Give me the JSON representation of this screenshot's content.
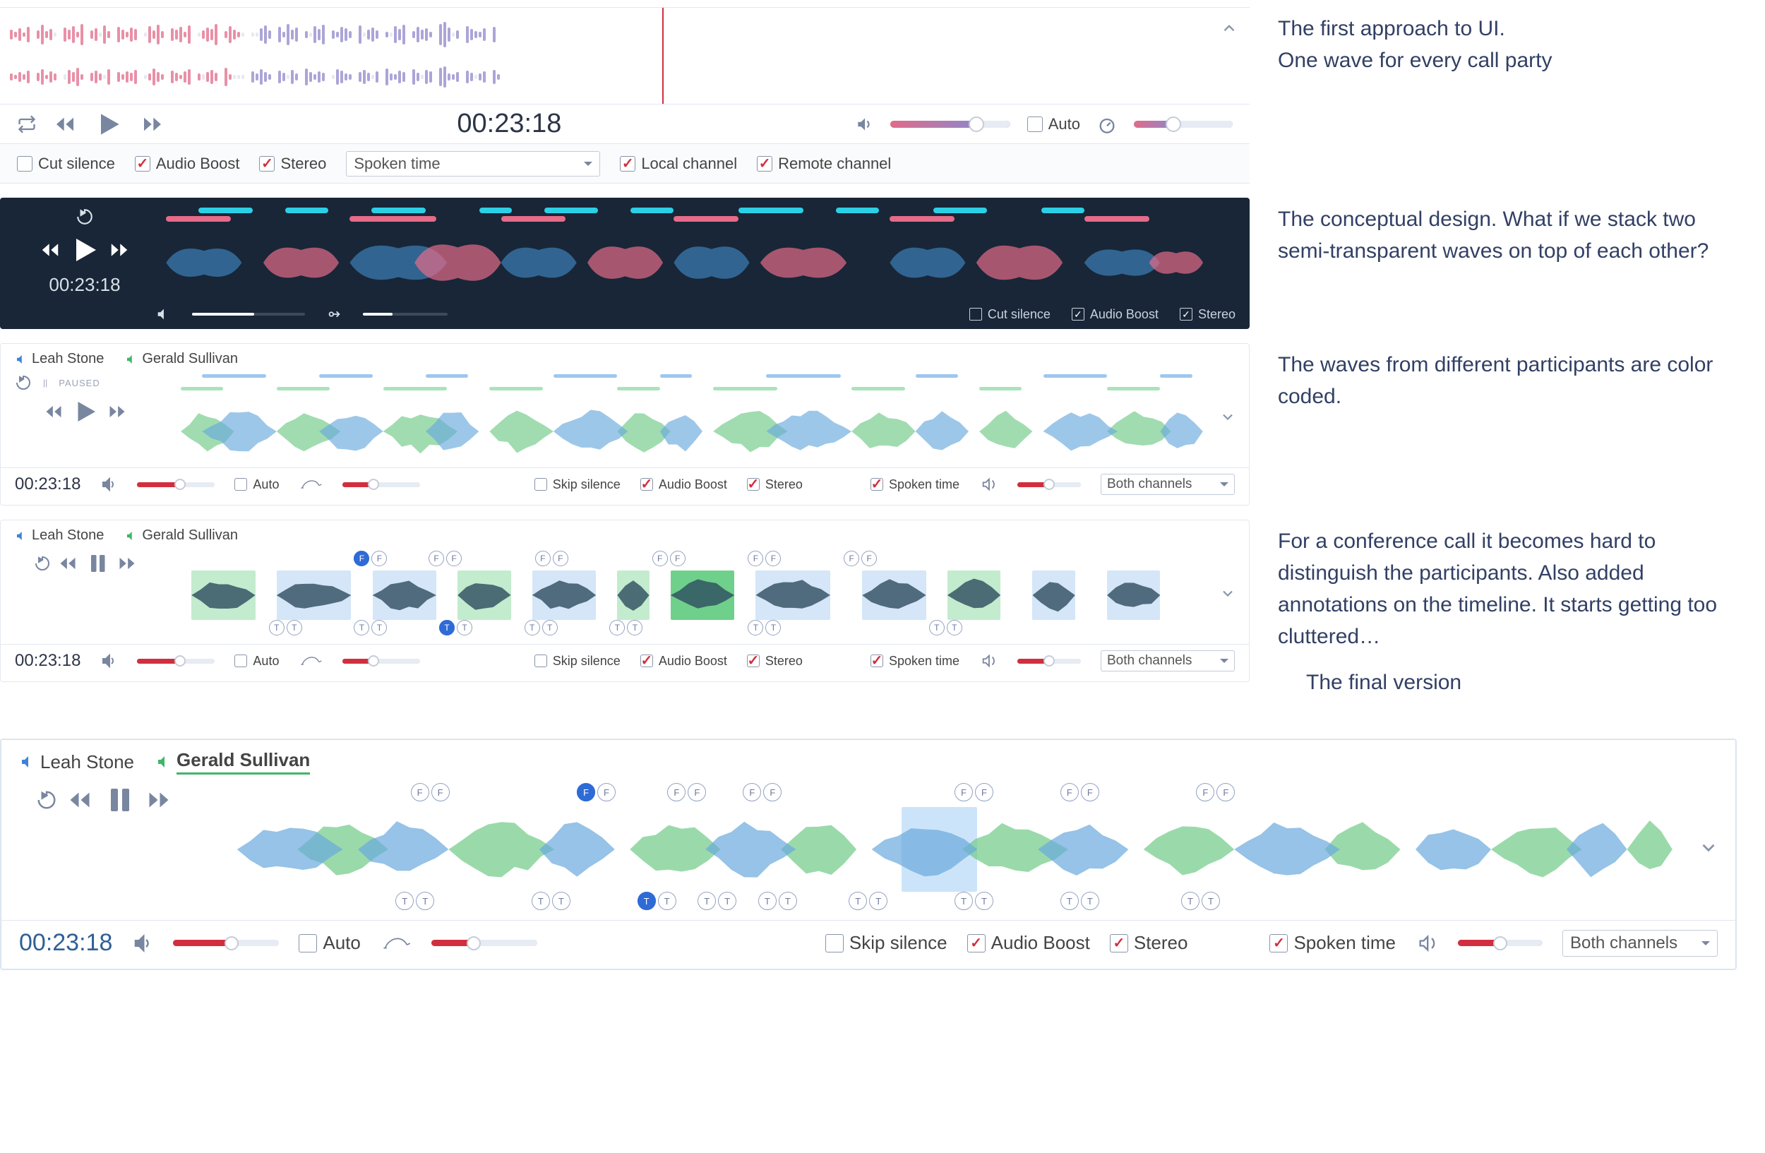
{
  "captions": {
    "c1a": "The first approach to UI.",
    "c1b": "One wave for every call party",
    "c2": "The conceptual design. What if we stack two semi-transparent waves on top of each other?",
    "c3": "The waves from different participants are color coded.",
    "c4": "For a conference call it becomes hard to distinguish the participants. Also added annotations on the timeline. It starts getting too cluttered…",
    "c5": "The final version"
  },
  "participants": {
    "a": "Leah Stone",
    "b": "Gerald Sullivan"
  },
  "time": "00:23:18",
  "paused": "PAUSED",
  "selectors": {
    "spoken": "Spoken time",
    "both": "Both channels"
  },
  "options": {
    "cut": "Cut silence",
    "boost": "Audio Boost",
    "stereo": "Stereo",
    "local": "Local channel",
    "remote": "Remote channel",
    "auto": "Auto",
    "skip": "Skip silence",
    "spoken": "Spoken time"
  },
  "waves1": {
    "top": [
      [
        14,
        "p"
      ],
      [
        8,
        "p"
      ],
      [
        18,
        "p"
      ],
      [
        6,
        "p"
      ],
      [
        22,
        "p"
      ],
      [
        12,
        "p"
      ],
      [
        28,
        "p"
      ],
      [
        10,
        "p"
      ],
      [
        16,
        "p"
      ],
      [
        6,
        "g"
      ],
      [
        20,
        "p"
      ],
      [
        14,
        "p"
      ],
      [
        24,
        "p"
      ],
      [
        8,
        "p"
      ],
      [
        30,
        "p"
      ],
      [
        12,
        "p"
      ],
      [
        18,
        "p"
      ],
      [
        6,
        "g"
      ],
      [
        26,
        "p"
      ],
      [
        10,
        "p"
      ],
      [
        22,
        "p"
      ],
      [
        14,
        "p"
      ],
      [
        8,
        "p"
      ],
      [
        20,
        "p"
      ],
      [
        16,
        "p"
      ],
      [
        6,
        "g"
      ],
      [
        24,
        "p"
      ],
      [
        12,
        "p"
      ],
      [
        28,
        "p"
      ],
      [
        10,
        "p"
      ],
      [
        18,
        "p"
      ],
      [
        14,
        "p"
      ],
      [
        22,
        "p"
      ],
      [
        8,
        "p"
      ],
      [
        26,
        "p"
      ],
      [
        6,
        "g"
      ],
      [
        12,
        "p"
      ],
      [
        20,
        "p"
      ],
      [
        16,
        "p"
      ],
      [
        30,
        "p"
      ],
      [
        10,
        "p"
      ],
      [
        24,
        "p"
      ],
      [
        14,
        "p"
      ],
      [
        8,
        "p"
      ],
      [
        6,
        "g"
      ],
      [
        6,
        "g"
      ],
      [
        6,
        "g"
      ],
      [
        18,
        "u"
      ],
      [
        26,
        "u"
      ],
      [
        12,
        "u"
      ],
      [
        22,
        "u"
      ],
      [
        8,
        "u"
      ],
      [
        30,
        "u"
      ],
      [
        14,
        "u"
      ],
      [
        20,
        "u"
      ],
      [
        10,
        "u"
      ],
      [
        6,
        "g"
      ],
      [
        24,
        "u"
      ],
      [
        16,
        "u"
      ],
      [
        28,
        "u"
      ],
      [
        12,
        "u"
      ],
      [
        8,
        "u"
      ],
      [
        22,
        "u"
      ],
      [
        18,
        "u"
      ],
      [
        10,
        "u"
      ],
      [
        26,
        "u"
      ],
      [
        6,
        "g"
      ],
      [
        14,
        "u"
      ],
      [
        20,
        "u"
      ],
      [
        12,
        "u"
      ],
      [
        8,
        "u"
      ],
      [
        6,
        "g"
      ],
      [
        24,
        "u"
      ],
      [
        16,
        "u"
      ],
      [
        28,
        "u"
      ],
      [
        10,
        "u"
      ],
      [
        22,
        "u"
      ],
      [
        14,
        "u"
      ],
      [
        18,
        "u"
      ],
      [
        8,
        "u"
      ],
      [
        30,
        "u"
      ],
      [
        36,
        "u"
      ],
      [
        20,
        "u"
      ],
      [
        6,
        "g"
      ],
      [
        12,
        "u"
      ],
      [
        24,
        "u"
      ],
      [
        16,
        "u"
      ],
      [
        10,
        "u"
      ],
      [
        8,
        "u"
      ],
      [
        18,
        "u"
      ],
      [
        22,
        "u"
      ]
    ],
    "bot": [
      [
        10,
        "p"
      ],
      [
        6,
        "p"
      ],
      [
        14,
        "p"
      ],
      [
        8,
        "p"
      ],
      [
        18,
        "p"
      ],
      [
        12,
        "p"
      ],
      [
        22,
        "p"
      ],
      [
        6,
        "p"
      ],
      [
        16,
        "p"
      ],
      [
        10,
        "p"
      ],
      [
        8,
        "g"
      ],
      [
        20,
        "p"
      ],
      [
        14,
        "p"
      ],
      [
        26,
        "p"
      ],
      [
        8,
        "p"
      ],
      [
        12,
        "p"
      ],
      [
        18,
        "p"
      ],
      [
        10,
        "p"
      ],
      [
        6,
        "g"
      ],
      [
        22,
        "p"
      ],
      [
        14,
        "p"
      ],
      [
        8,
        "p"
      ],
      [
        16,
        "p"
      ],
      [
        12,
        "p"
      ],
      [
        20,
        "p"
      ],
      [
        6,
        "g"
      ],
      [
        10,
        "p"
      ],
      [
        24,
        "p"
      ],
      [
        14,
        "p"
      ],
      [
        8,
        "p"
      ],
      [
        18,
        "p"
      ],
      [
        12,
        "p"
      ],
      [
        6,
        "p"
      ],
      [
        16,
        "p"
      ],
      [
        22,
        "p"
      ],
      [
        10,
        "p"
      ],
      [
        8,
        "g"
      ],
      [
        14,
        "p"
      ],
      [
        20,
        "p"
      ],
      [
        12,
        "p"
      ],
      [
        26,
        "p"
      ],
      [
        8,
        "p"
      ],
      [
        6,
        "g"
      ],
      [
        6,
        "g"
      ],
      [
        6,
        "g"
      ],
      [
        16,
        "u"
      ],
      [
        10,
        "u"
      ],
      [
        22,
        "u"
      ],
      [
        14,
        "u"
      ],
      [
        8,
        "u"
      ],
      [
        18,
        "u"
      ],
      [
        12,
        "u"
      ],
      [
        6,
        "g"
      ],
      [
        20,
        "u"
      ],
      [
        10,
        "u"
      ],
      [
        24,
        "u"
      ],
      [
        14,
        "u"
      ],
      [
        8,
        "u"
      ],
      [
        16,
        "u"
      ],
      [
        12,
        "u"
      ],
      [
        6,
        "g"
      ],
      [
        22,
        "u"
      ],
      [
        18,
        "u"
      ],
      [
        10,
        "u"
      ],
      [
        8,
        "u"
      ],
      [
        14,
        "u"
      ],
      [
        20,
        "u"
      ],
      [
        12,
        "u"
      ],
      [
        6,
        "g"
      ],
      [
        16,
        "u"
      ],
      [
        24,
        "u"
      ],
      [
        10,
        "u"
      ],
      [
        8,
        "u"
      ],
      [
        18,
        "u"
      ],
      [
        14,
        "u"
      ],
      [
        22,
        "u"
      ],
      [
        12,
        "u"
      ],
      [
        6,
        "g"
      ],
      [
        20,
        "u"
      ],
      [
        16,
        "u"
      ],
      [
        26,
        "u"
      ],
      [
        30,
        "u"
      ],
      [
        10,
        "u"
      ],
      [
        8,
        "u"
      ],
      [
        14,
        "u"
      ],
      [
        18,
        "u"
      ],
      [
        12,
        "u"
      ],
      [
        6,
        "g"
      ],
      [
        10,
        "u"
      ],
      [
        16,
        "u"
      ],
      [
        20,
        "u"
      ],
      [
        8,
        "u"
      ]
    ]
  },
  "segments2": {
    "cyan": [
      [
        4,
        5
      ],
      [
        12,
        4
      ],
      [
        20,
        5
      ],
      [
        30,
        3
      ],
      [
        36,
        5
      ],
      [
        44,
        4
      ],
      [
        54,
        6
      ],
      [
        63,
        4
      ],
      [
        72,
        5
      ],
      [
        82,
        4
      ]
    ],
    "pink": [
      [
        1,
        6
      ],
      [
        18,
        8
      ],
      [
        32,
        6
      ],
      [
        48,
        6
      ],
      [
        68,
        6
      ],
      [
        86,
        6
      ]
    ]
  },
  "blobs2": {
    "blue": [
      [
        1,
        7,
        28
      ],
      [
        18,
        9,
        34
      ],
      [
        32,
        7,
        30
      ],
      [
        48,
        7,
        32
      ],
      [
        68,
        7,
        30
      ],
      [
        86,
        7,
        26
      ]
    ],
    "pink": [
      [
        10,
        7,
        30
      ],
      [
        24,
        8,
        36
      ],
      [
        40,
        7,
        32
      ],
      [
        56,
        8,
        30
      ],
      [
        76,
        8,
        34
      ],
      [
        92,
        5,
        22
      ]
    ]
  },
  "segments3": {
    "blue": [
      [
        3,
        6
      ],
      [
        14,
        5
      ],
      [
        24,
        4
      ],
      [
        36,
        6
      ],
      [
        46,
        3
      ],
      [
        56,
        7
      ],
      [
        70,
        4
      ],
      [
        82,
        6
      ],
      [
        93,
        3
      ]
    ],
    "green": [
      [
        1,
        4
      ],
      [
        10,
        5
      ],
      [
        20,
        6
      ],
      [
        30,
        5
      ],
      [
        42,
        4
      ],
      [
        51,
        6
      ],
      [
        64,
        5
      ],
      [
        76,
        4
      ],
      [
        88,
        5
      ]
    ]
  },
  "wave3": {
    "blue": [
      [
        3,
        7
      ],
      [
        14,
        6
      ],
      [
        24,
        5
      ],
      [
        36,
        7
      ],
      [
        46,
        4
      ],
      [
        56,
        8
      ],
      [
        70,
        5
      ],
      [
        82,
        7
      ],
      [
        93,
        4
      ]
    ],
    "green": [
      [
        1,
        5
      ],
      [
        10,
        6
      ],
      [
        20,
        7
      ],
      [
        30,
        6
      ],
      [
        42,
        5
      ],
      [
        51,
        7
      ],
      [
        64,
        6
      ],
      [
        76,
        5
      ],
      [
        88,
        6
      ]
    ]
  },
  "blocks4": [
    [
      2,
      6,
      "g"
    ],
    [
      10,
      7,
      "b"
    ],
    [
      19,
      6,
      "b"
    ],
    [
      27,
      5,
      "g"
    ],
    [
      34,
      6,
      "b"
    ],
    [
      42,
      3,
      "g"
    ],
    [
      47,
      6,
      "g2"
    ],
    [
      55,
      7,
      "b"
    ],
    [
      65,
      6,
      "b"
    ],
    [
      73,
      5,
      "g"
    ],
    [
      81,
      4,
      "b"
    ],
    [
      88,
      5,
      "b"
    ]
  ],
  "markers4": {
    "top": [
      [
        18,
        "F"
      ],
      [
        25,
        "F"
      ],
      [
        35,
        "F"
      ],
      [
        46,
        "F"
      ],
      [
        55,
        "F"
      ],
      [
        64,
        "F"
      ]
    ],
    "topfill": [
      [
        18
      ]
    ],
    "bot": [
      [
        10,
        "T"
      ],
      [
        18,
        "T"
      ],
      [
        26,
        "T"
      ],
      [
        34,
        "T"
      ],
      [
        42,
        "T"
      ],
      [
        55,
        "T"
      ],
      [
        72,
        "T"
      ]
    ],
    "botfill": [
      [
        26
      ]
    ]
  },
  "final": {
    "blocks": [
      [
        46,
        5
      ]
    ],
    "wave": {
      "blue": [
        [
          2,
          7
        ],
        [
          10,
          6
        ],
        [
          22,
          5
        ],
        [
          33,
          6
        ],
        [
          44,
          7
        ],
        [
          55,
          6
        ],
        [
          68,
          7
        ],
        [
          80,
          5
        ],
        [
          90,
          4
        ]
      ],
      "green": [
        [
          6,
          6
        ],
        [
          16,
          7
        ],
        [
          28,
          6
        ],
        [
          38,
          5
        ],
        [
          50,
          7
        ],
        [
          62,
          6
        ],
        [
          74,
          5
        ],
        [
          85,
          6
        ],
        [
          94,
          3
        ]
      ]
    },
    "markersTop": [
      [
        14,
        "F"
      ],
      [
        25,
        "F"
      ],
      [
        31,
        "F"
      ],
      [
        36,
        "F"
      ],
      [
        50,
        "F"
      ],
      [
        57,
        "F"
      ],
      [
        66,
        "F"
      ]
    ],
    "markersTopFill": [
      [
        25
      ]
    ],
    "markersBot": [
      [
        13,
        "T"
      ],
      [
        22,
        "T"
      ],
      [
        29,
        "T"
      ],
      [
        33,
        "T"
      ],
      [
        37,
        "T"
      ],
      [
        43,
        "T"
      ],
      [
        50,
        "T"
      ],
      [
        57,
        "T"
      ],
      [
        65,
        "T"
      ]
    ],
    "markersBotFill": [
      [
        29
      ]
    ]
  }
}
